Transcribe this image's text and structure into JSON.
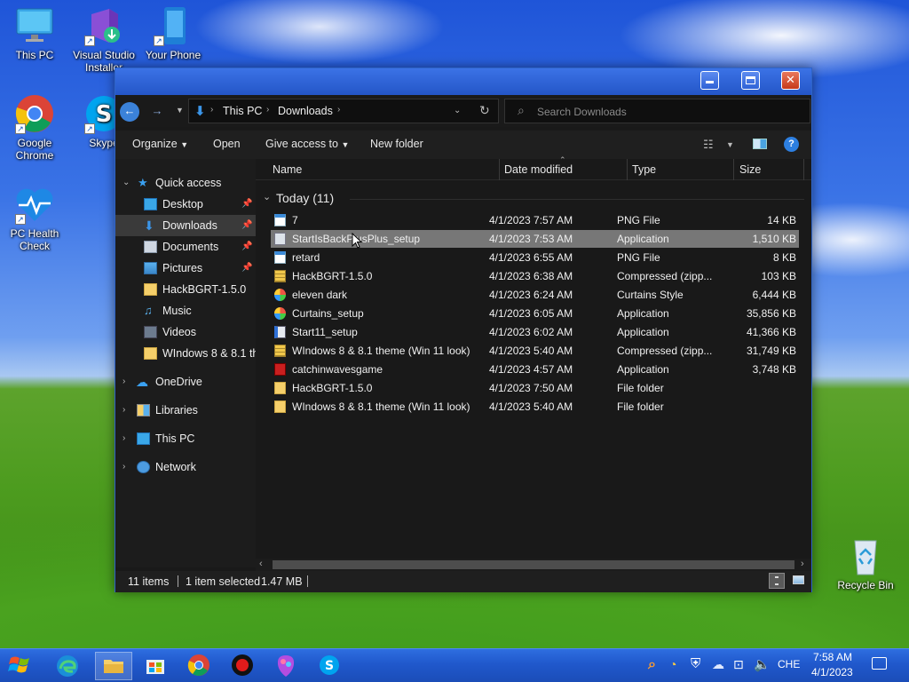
{
  "desktop": {
    "icons": [
      {
        "label": "This PC"
      },
      {
        "label": "Visual Studio Installer"
      },
      {
        "label": "Your Phone"
      },
      {
        "label": "Google Chrome"
      },
      {
        "label": "Skype"
      },
      {
        "label": "PC Health Check"
      },
      {
        "label": "Recycle Bin"
      }
    ]
  },
  "window": {
    "address": {
      "crumbs": [
        "This PC",
        "Downloads"
      ]
    },
    "search": {
      "placeholder": "Search Downloads"
    },
    "commands": {
      "organize": "Organize",
      "open": "Open",
      "give_access": "Give access to",
      "new_folder": "New folder"
    },
    "nav": [
      {
        "label": "Quick access",
        "icon": "star-icon"
      },
      {
        "label": "Desktop",
        "icon": "desktop-icon"
      },
      {
        "label": "Downloads",
        "icon": "download-icon"
      },
      {
        "label": "Documents",
        "icon": "documents-icon"
      },
      {
        "label": "Pictures",
        "icon": "pictures-icon"
      },
      {
        "label": "HackBGRT-1.5.0",
        "icon": "folder-icon"
      },
      {
        "label": "Music",
        "icon": "music-icon"
      },
      {
        "label": "Videos",
        "icon": "videos-icon"
      },
      {
        "label": "WIndows 8 & 8.1 th",
        "icon": "folder-icon"
      },
      {
        "label": "OneDrive",
        "icon": "cloud-icon"
      },
      {
        "label": "Libraries",
        "icon": "libraries-icon"
      },
      {
        "label": "This PC",
        "icon": "computer-icon"
      },
      {
        "label": "Network",
        "icon": "network-icon"
      }
    ],
    "columns": {
      "name": "Name",
      "date": "Date modified",
      "type": "Type",
      "size": "Size"
    },
    "group": {
      "label": "Today (11)"
    },
    "files": [
      {
        "name": "7",
        "date": "4/1/2023 7:57 AM",
        "type": "PNG File",
        "size": "14 KB"
      },
      {
        "name": "StartIsBackPlusPlus_setup",
        "date": "4/1/2023 7:53 AM",
        "type": "Application",
        "size": "1,510 KB"
      },
      {
        "name": "retard",
        "date": "4/1/2023 6:55 AM",
        "type": "PNG File",
        "size": "8 KB"
      },
      {
        "name": "HackBGRT-1.5.0",
        "date": "4/1/2023 6:38 AM",
        "type": "Compressed (zipp...",
        "size": "103 KB"
      },
      {
        "name": "eleven dark",
        "date": "4/1/2023 6:24 AM",
        "type": "Curtains Style",
        "size": "6,444 KB"
      },
      {
        "name": "Curtains_setup",
        "date": "4/1/2023 6:05 AM",
        "type": "Application",
        "size": "35,856 KB"
      },
      {
        "name": "Start11_setup",
        "date": "4/1/2023 6:02 AM",
        "type": "Application",
        "size": "41,366 KB"
      },
      {
        "name": "WIndows 8 & 8.1 theme (Win 11 look)",
        "date": "4/1/2023 5:40 AM",
        "type": "Compressed (zipp...",
        "size": "31,749 KB"
      },
      {
        "name": "catchinwavesgame",
        "date": "4/1/2023 4:57 AM",
        "type": "Application",
        "size": "3,748 KB"
      },
      {
        "name": "HackBGRT-1.5.0",
        "date": "4/1/2023 7:50 AM",
        "type": "File folder",
        "size": ""
      },
      {
        "name": "WIndows 8 & 8.1 theme (Win 11 look)",
        "date": "4/1/2023 5:40 AM",
        "type": "File folder",
        "size": ""
      }
    ],
    "status": {
      "items": "11 items",
      "selected": "1 item selected",
      "size": "1.47 MB"
    }
  },
  "taskbar": {
    "lang": "CHE",
    "time": "7:58 AM",
    "date": "4/1/2023"
  },
  "colors": {
    "titlebar": "#2a5fd6",
    "taskbar": "#2058cc",
    "selection": "#777777"
  }
}
